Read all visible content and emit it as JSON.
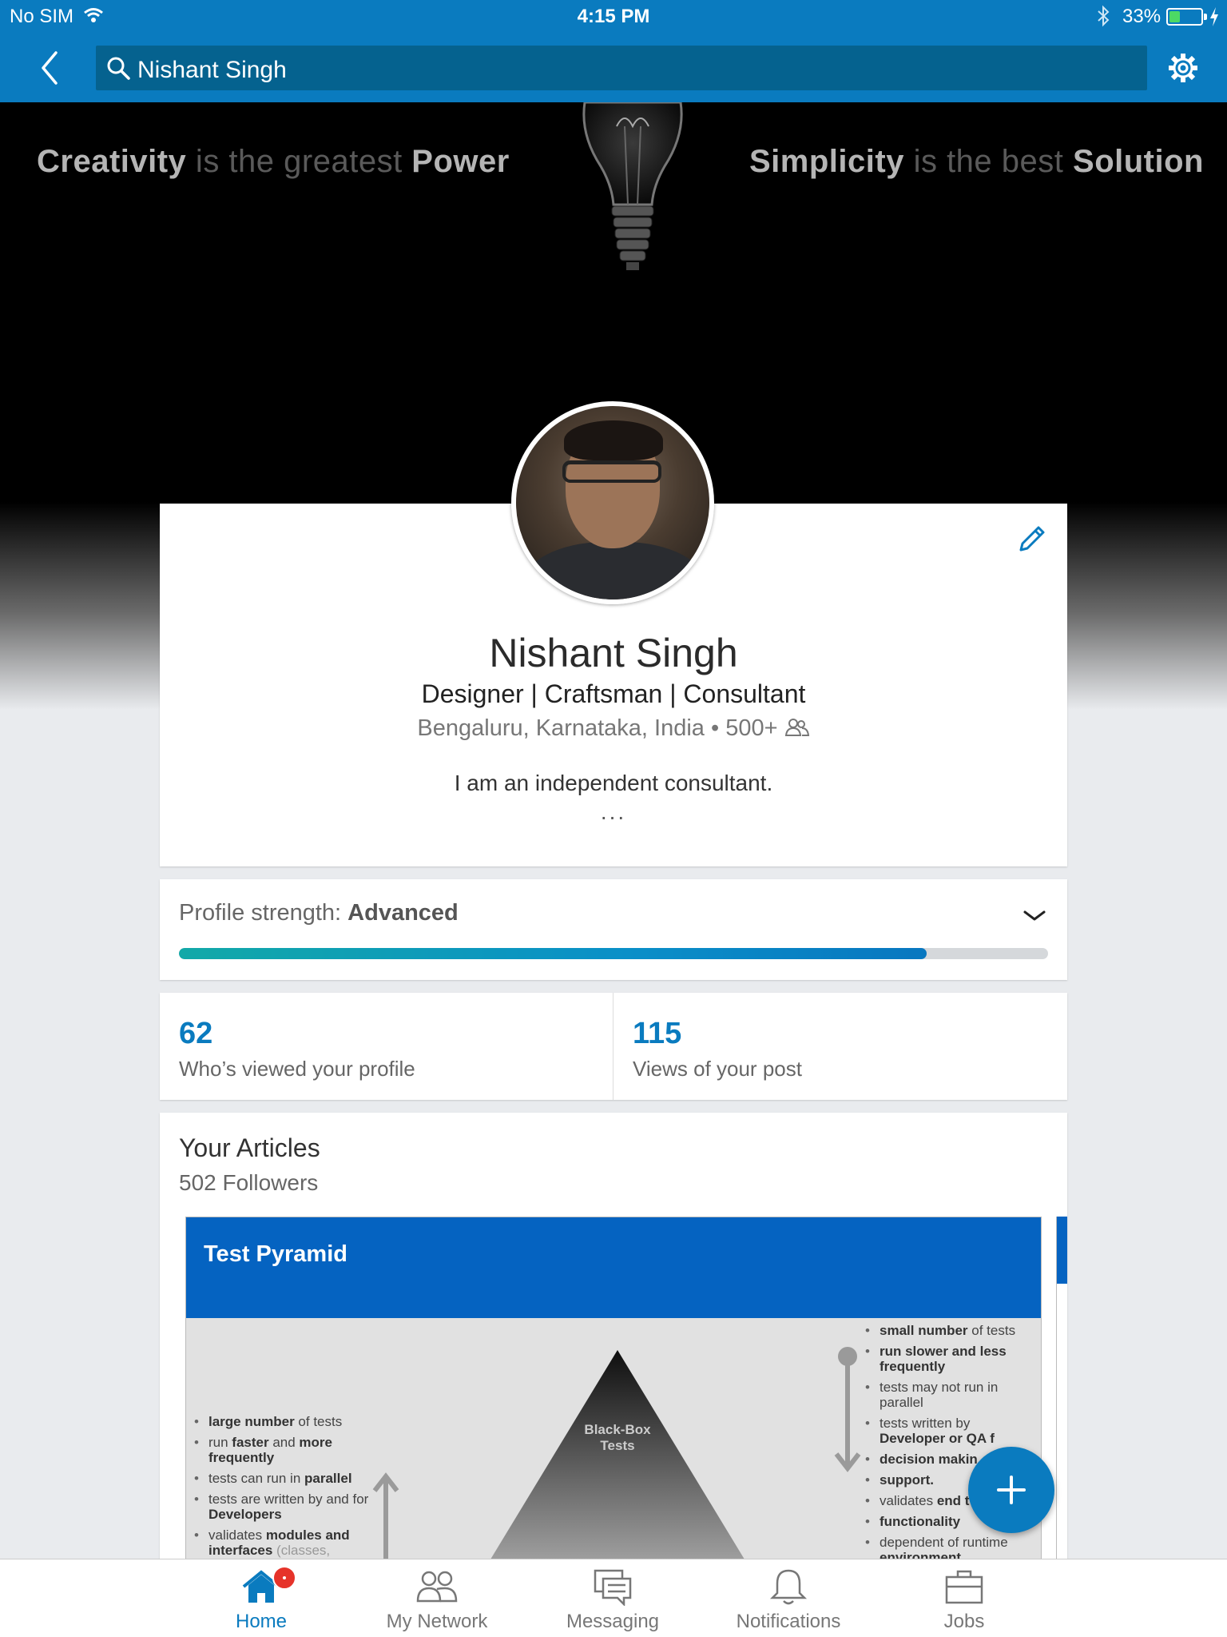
{
  "status_bar": {
    "carrier": "No SIM",
    "time": "4:15 PM",
    "battery_percent": "33%",
    "battery_level": 0.33,
    "icons": [
      "wifi-icon",
      "bluetooth-icon",
      "battery-icon",
      "charging-icon"
    ]
  },
  "nav": {
    "search_value": "Nishant Singh",
    "icons": [
      "back-chevron-icon",
      "search-icon",
      "gear-icon"
    ]
  },
  "banner": {
    "left_quote": {
      "strong1": "Creativity",
      "mid": " is the greatest ",
      "strong2": "Power"
    },
    "right_quote": {
      "strong1": "Simplicity",
      "mid": " is the best ",
      "strong2": "Solution"
    }
  },
  "profile": {
    "name": "Nishant Singh",
    "headline": "Designer | Craftsman | Consultant",
    "location": "Bengaluru, Karnataka, India",
    "separator": " • ",
    "connections": "500+",
    "summary": "I am an independent consultant.",
    "more": "...",
    "icons": [
      "pencil-icon",
      "connections-icon"
    ]
  },
  "profile_strength": {
    "label": "Profile strength: ",
    "level": "Advanced",
    "progress": 0.86,
    "colors": {
      "start": "#12a9a8",
      "end": "#0877c0"
    }
  },
  "stats": {
    "views_profile": {
      "value": "62",
      "label": "Who’s viewed your profile"
    },
    "views_post": {
      "value": "115",
      "label": "Views of your post"
    }
  },
  "articles": {
    "title": "Your Articles",
    "followers": "502 Followers",
    "tile": {
      "title": "Test Pyramid",
      "pyramid_label": "Black-Box Tests",
      "left_items": [
        {
          "b": "large number",
          "t": " of tests"
        },
        {
          "t": "run ",
          "b": "faster",
          "t2": " and ",
          "b2": "more frequently"
        },
        {
          "t": "tests can run in ",
          "b": "parallel"
        },
        {
          "t": "tests are written by and for ",
          "b": "Developers"
        },
        {
          "t": "validates ",
          "b": "modules and interfaces",
          "g": " (classes,"
        }
      ],
      "right_items": [
        {
          "b": "small number",
          "t": " of tests"
        },
        {
          "b": "run slower and less frequently"
        },
        {
          "t": "tests may not run in parallel"
        },
        {
          "t": "tests written by ",
          "b": "Developer or QA f"
        },
        {
          "b": "decision makin"
        },
        {
          "b": "support."
        },
        {
          "t": "validates ",
          "b": "end t"
        },
        {
          "b": "functionality"
        },
        {
          "t": "dependent of runtime ",
          "b": "environment"
        }
      ]
    }
  },
  "fab": {
    "icon": "plus-icon"
  },
  "tabs": [
    {
      "label": "Home",
      "icon": "home-icon",
      "active": true,
      "badge": true
    },
    {
      "label": "My Network",
      "icon": "network-icon",
      "active": false
    },
    {
      "label": "Messaging",
      "icon": "messaging-icon",
      "active": false
    },
    {
      "label": "Notifications",
      "icon": "bell-icon",
      "active": false
    },
    {
      "label": "Jobs",
      "icon": "briefcase-icon",
      "active": false
    }
  ],
  "colors": {
    "brand_blue": "#0a7bbf",
    "search_bg": "#05628f",
    "article_blue": "#0563c1",
    "badge_red": "#e6332a"
  }
}
